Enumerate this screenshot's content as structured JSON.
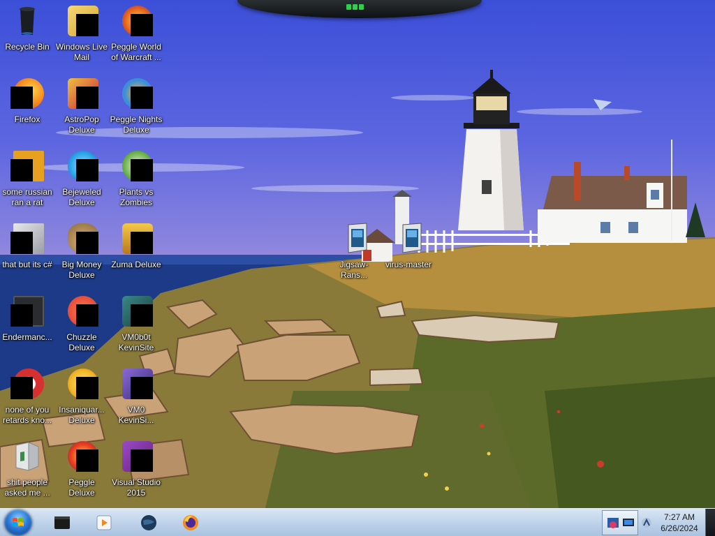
{
  "desktop": {
    "icons": [
      {
        "id": "recycle-bin",
        "label": "Recycle Bin",
        "icon": "recycle-bin-icon",
        "color": "#1a1d22",
        "masked": false
      },
      {
        "id": "windows-live-mail",
        "label": "Windows Live Mail",
        "icon": "mail-icon",
        "color": "#e3b94a",
        "masked": true
      },
      {
        "id": "peggle-world-of-warcraft",
        "label": "Peggle World of Warcraft ...",
        "icon": "peggle-icon",
        "color": "#e86a1c",
        "masked": true
      },
      {
        "id": "firefox",
        "label": "Firefox",
        "icon": "firefox-icon",
        "color": "#f58b1f",
        "masked": true
      },
      {
        "id": "astropop-deluxe",
        "label": "AstroPop Deluxe",
        "icon": "astropop-icon",
        "color": "#c6243a",
        "masked": true
      },
      {
        "id": "peggle-nights-deluxe",
        "label": "Peggle Nights Deluxe",
        "icon": "peggle-nights-icon",
        "color": "#3a8fd8",
        "masked": true
      },
      {
        "id": "some-russian-ran-a-rat",
        "label": "some russian ran a rat",
        "icon": "document-icon",
        "color": "#e8a020",
        "masked": true
      },
      {
        "id": "bejeweled-deluxe",
        "label": "Bejeweled Deluxe",
        "icon": "bejeweled-icon",
        "color": "#2aa4e8",
        "masked": true
      },
      {
        "id": "plants-vs-zombies",
        "label": "Plants vs Zombies",
        "icon": "plants-icon",
        "color": "#5aa838",
        "masked": true
      },
      {
        "id": "that-but-its-c",
        "label": "that but its c#",
        "icon": "stack-icon",
        "color": "#b8bcc4",
        "masked": true
      },
      {
        "id": "big-money-deluxe",
        "label": "Big Money Deluxe",
        "icon": "money-bag-icon",
        "color": "#b08a4a",
        "masked": true
      },
      {
        "id": "zuma-deluxe",
        "label": "Zuma Deluxe",
        "icon": "zuma-icon",
        "color": "#d8a028",
        "masked": true
      },
      {
        "id": "endermanc",
        "label": "Endermanc...",
        "icon": "console-icon",
        "color": "#2a2d30",
        "masked": true
      },
      {
        "id": "chuzzle-deluxe",
        "label": "Chuzzle Deluxe",
        "icon": "chuzzle-icon",
        "color": "#d83a2a",
        "masked": true
      },
      {
        "id": "vm0b0t-kevinsite",
        "label": "VM0b0t KevinSite",
        "icon": "vm-icon",
        "color": "#2d6a6a",
        "masked": true
      },
      {
        "id": "none-of-you-retards",
        "label": "none of you retards kno...",
        "icon": "opera-icon",
        "color": "#d83030",
        "masked": true
      },
      {
        "id": "insaniquarium-deluxe",
        "label": "Insaniquar... Deluxe",
        "icon": "fish-icon",
        "color": "#f0b828",
        "masked": true
      },
      {
        "id": "vm0-kevinsi",
        "label": "VM0 KevinSi...",
        "icon": "vm-icon",
        "color": "#5a3aa8",
        "masked": true
      },
      {
        "id": "shit-people-asked-me",
        "label": "shit people asked me ...",
        "icon": "folder-open-icon",
        "color": "#c8c8c8",
        "masked": false
      },
      {
        "id": "peggle-deluxe",
        "label": "Peggle Deluxe",
        "icon": "peggle-icon",
        "color": "#e8401c",
        "masked": true
      },
      {
        "id": "visual-studio-2015",
        "label": "Visual Studio 2015",
        "icon": "visual-studio-icon",
        "color": "#68217a",
        "masked": true
      },
      {
        "id": "jigsaw-ransomware",
        "label": "Jigsaw-Rans...",
        "icon": "app-window-icon",
        "color": "#1f5a8a",
        "masked": false
      },
      {
        "id": "virus-master",
        "label": "virus-master",
        "icon": "app-window-icon",
        "color": "#1f5a8a",
        "masked": false
      }
    ]
  },
  "taskbar": {
    "start_label": "Start",
    "pinned": [
      {
        "id": "terminal",
        "icon": "terminal-icon"
      },
      {
        "id": "media-player",
        "icon": "media-player-icon"
      },
      {
        "id": "globe",
        "icon": "globe-icon"
      },
      {
        "id": "firefox",
        "icon": "firefox-icon"
      }
    ],
    "clock": {
      "time": "7:27 AM",
      "date": "6/26/2024"
    }
  }
}
